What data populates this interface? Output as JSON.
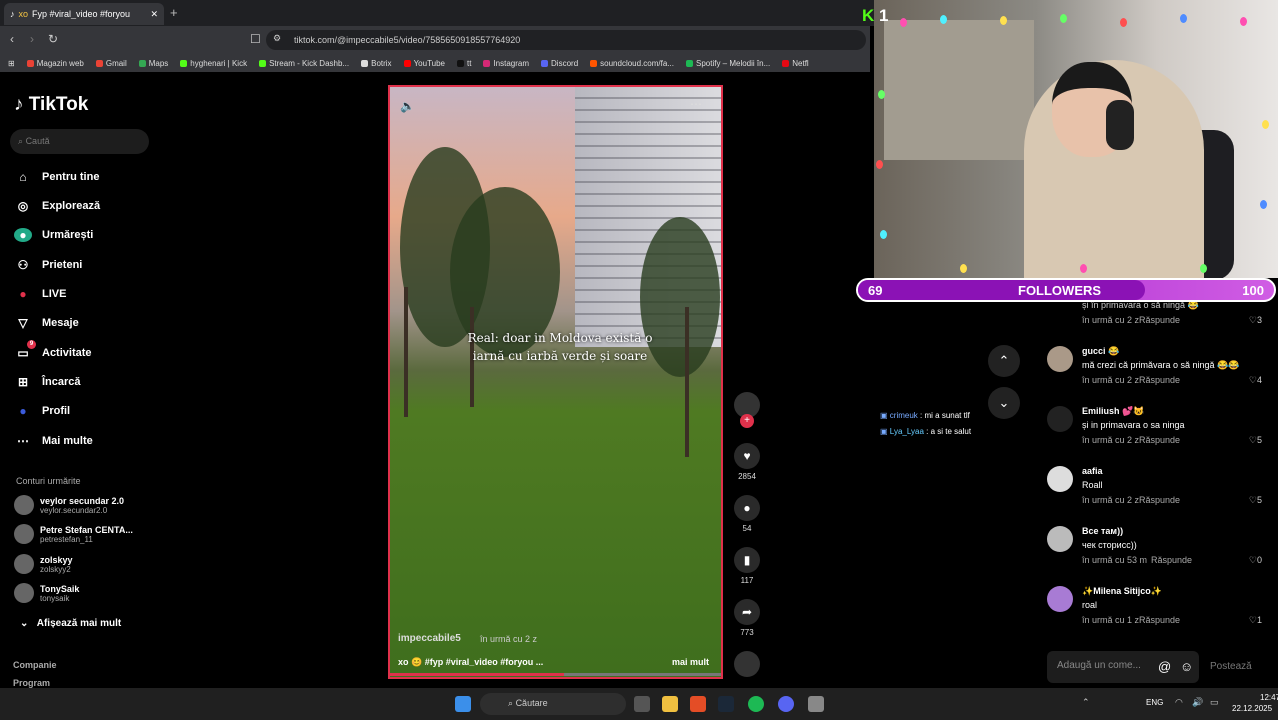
{
  "browser": {
    "tab_title": "Fyp #viral_video #foryou",
    "tab_prefix": "xo",
    "url": "tiktok.com/@impeccabile5/video/7585650918557764920",
    "bookmarks": [
      "Magazin web",
      "Gmail",
      "Maps",
      "hyghenari | Kick",
      "Stream - Kick Dashb...",
      "Botrix",
      "YouTube",
      "tt",
      "Instagram",
      "Discord",
      "soundcloud.com/fa...",
      "Spotify – Melodii în...",
      "Netfl"
    ]
  },
  "sidebar": {
    "logo": "TikTok",
    "search_placeholder": "Caută",
    "nav": [
      {
        "label": "Pentru tine",
        "icon": "home-icon"
      },
      {
        "label": "Explorează",
        "icon": "compass-icon"
      },
      {
        "label": "Urmărești",
        "icon": "following-icon"
      },
      {
        "label": "Prieteni",
        "icon": "friends-icon"
      },
      {
        "label": "LIVE",
        "icon": "live-icon"
      },
      {
        "label": "Mesaje",
        "icon": "messages-icon"
      },
      {
        "label": "Activitate",
        "icon": "activity-icon",
        "badge": "9"
      },
      {
        "label": "Încarcă",
        "icon": "upload-icon"
      },
      {
        "label": "Profil",
        "icon": "profile-icon"
      },
      {
        "label": "Mai multe",
        "icon": "more-icon"
      }
    ],
    "following_header": "Conturi urmărite",
    "accounts": [
      {
        "name": "veylor secundar 2.0",
        "handle": "veylor.secundar2.0"
      },
      {
        "name": "Petre Stefan CENTA...",
        "handle": "petrestefan_11"
      },
      {
        "name": "zolskyy",
        "handle": "zolskyy2"
      },
      {
        "name": "TonySaik",
        "handle": "tonysaik"
      }
    ],
    "show_more": "Afișează mai mult",
    "footer": [
      "Companie",
      "Program"
    ]
  },
  "video": {
    "caption_line1": "Real: doar in Moldova există o",
    "caption_line2": "iarnă cu iarbă verde și soare",
    "username": "impeccabile5",
    "time": "în urmă cu 2 z",
    "tags": "xo 😊 #fyp #viral_video #foryou ...",
    "more": "mai mult",
    "progress": 0.52
  },
  "actions": {
    "likes": "2854",
    "comments": "54",
    "saves": "117",
    "shares": "773"
  },
  "stream": {
    "kick_count": "1",
    "follow_current": "69",
    "follow_label": "FOLLOWERS",
    "follow_goal": "100",
    "follow_progress": 0.69,
    "chat": [
      {
        "user": "crimeuk",
        "text": ": mi a sunat tlf"
      },
      {
        "user": "Lya_Lyaa",
        "text": ": a si te salut"
      }
    ]
  },
  "comments": [
    {
      "user": "",
      "text": "și în primavara o să ningă 😂",
      "time": "în urmă cu 2 z",
      "reply": "Răspunde",
      "likes": "3"
    },
    {
      "user": "gucci 😂",
      "text": "mă crezi că primăvara o să ningă 😂😂",
      "time": "în urmă cu 2 z",
      "reply": "Răspunde",
      "likes": "4"
    },
    {
      "user": "Emiliush 💕😺",
      "text": "și in primavara o sa ninga",
      "time": "în urmă cu 2 z",
      "reply": "Răspunde",
      "likes": "5"
    },
    {
      "user": "ааfiа",
      "text": "Roall",
      "time": "în urmă cu 2 z",
      "reply": "Răspunde",
      "likes": "5"
    },
    {
      "user": "Все там))",
      "text": "чек сторисс))",
      "time": "în urmă cu 53 m",
      "reply": "Răspunde",
      "likes": "0"
    },
    {
      "user": "✨Milena Sitijco✨",
      "text": "roal",
      "time": "în urmă cu 1 z",
      "reply": "Răspunde",
      "likes": "1"
    }
  ],
  "comment_input": {
    "placeholder": "Adaugă un come...",
    "post": "Postează"
  },
  "taskbar": {
    "search": "Căutare",
    "lang": "ENG",
    "time": "12:47",
    "date": "22.12.2025"
  }
}
